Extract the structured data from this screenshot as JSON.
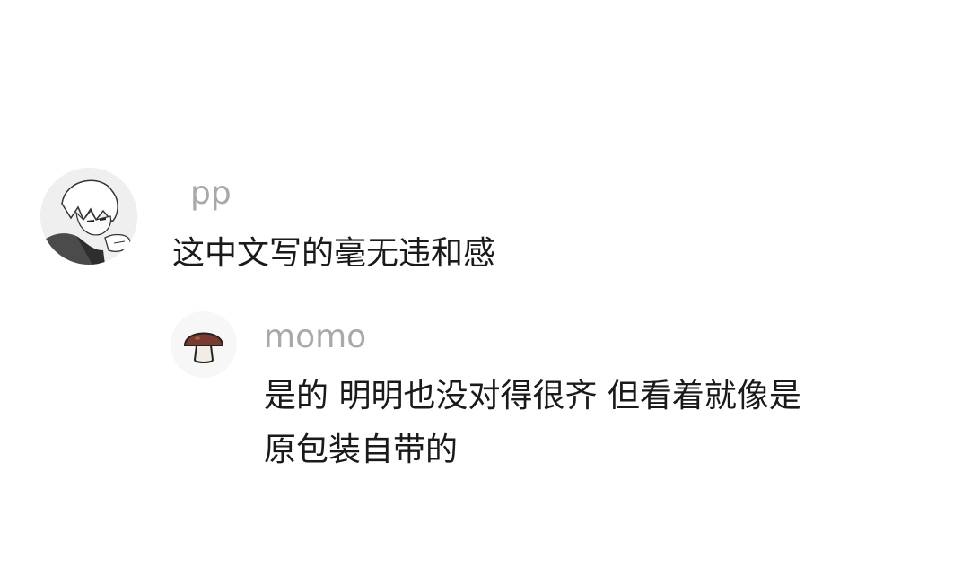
{
  "comments": [
    {
      "username": "pp",
      "text": "这中文写的毫无违和感",
      "avatar_icon": "manga-character-avatar"
    },
    {
      "username": "momo",
      "text_lines": [
        "是的 明明也没对得很齐 但看着就像是",
        "原包装自带的"
      ],
      "avatar_icon": "mushroom-avatar",
      "is_reply": true
    }
  ]
}
